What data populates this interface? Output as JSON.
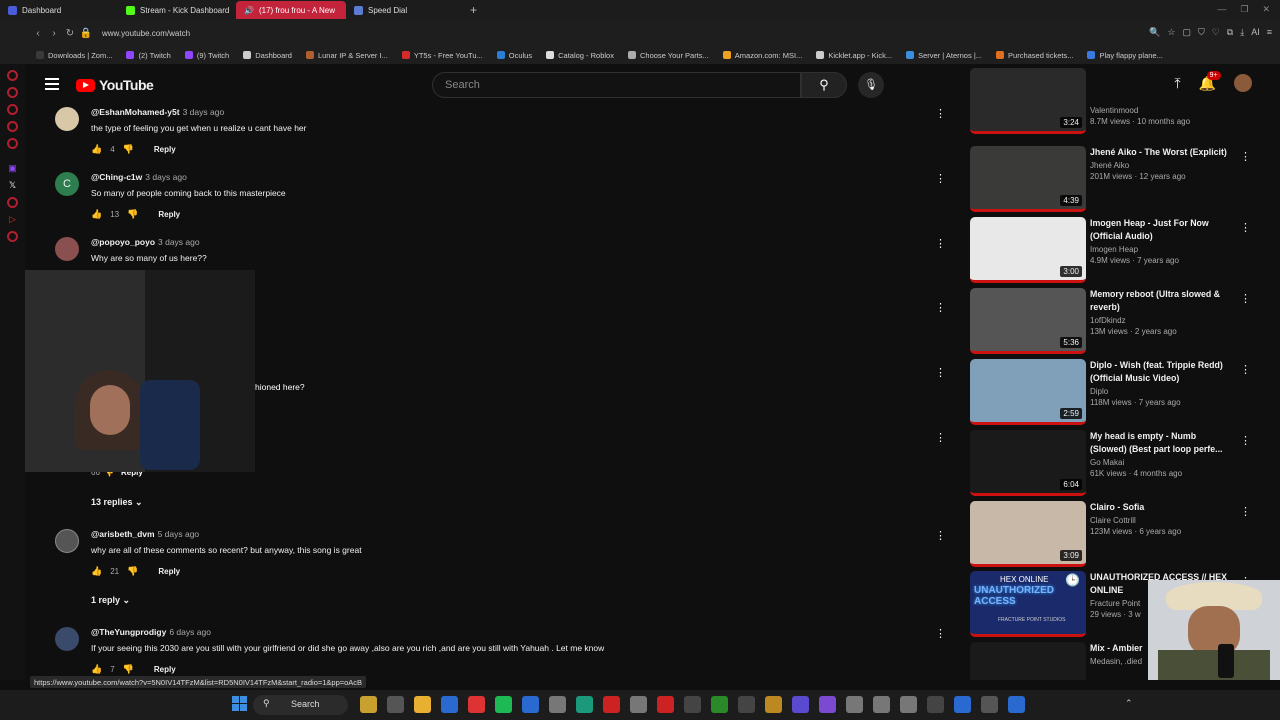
{
  "browser": {
    "tabs": [
      {
        "label": "Dashboard",
        "color": "#4a5cd8"
      },
      {
        "label": "Stream - Kick Dashboard",
        "color": "#53fc18"
      },
      {
        "label": "(17) frou frou - A New",
        "color": "#ffffff"
      },
      {
        "label": "Speed Dial",
        "color": "#5b7bd5"
      }
    ],
    "url": "www.youtube.com/watch",
    "bookmarks": [
      {
        "label": "Downloads | Zom...",
        "color": "#3a3a3a"
      },
      {
        "label": "(2) Twitch",
        "color": "#9146ff"
      },
      {
        "label": "(9) Twitch",
        "color": "#9146ff"
      },
      {
        "label": "Dashboard",
        "color": "#cccccc"
      },
      {
        "label": "Lunar IP & Server I...",
        "color": "#b06030"
      },
      {
        "label": "YT5s - Free YouTu...",
        "color": "#d42a2a"
      },
      {
        "label": "Oculus",
        "color": "#2a7fd4"
      },
      {
        "label": "Catalog - Roblox",
        "color": "#dddddd"
      },
      {
        "label": "Choose Your Parts...",
        "color": "#aaaaaa"
      },
      {
        "label": "Amazon.com: MSI...",
        "color": "#f0a020"
      },
      {
        "label": "Kicklet.app - Kick...",
        "color": "#cccccc"
      },
      {
        "label": "Server | Aternos |...",
        "color": "#3a8ee0"
      },
      {
        "label": "Purchased tickets...",
        "color": "#e07020"
      },
      {
        "label": "Play flappy plane...",
        "color": "#3a7ae0"
      }
    ]
  },
  "youtube": {
    "logo": "YouTube",
    "search_placeholder": "Search",
    "notif_badge": "9+",
    "comments": [
      {
        "user": "@EshanMohamed-y5t",
        "ago": "3 days ago",
        "text": "the type of feeling you get when u realize u cant have her",
        "likes": "4",
        "reply": "Reply",
        "avatar_color": "#d8c8a8"
      },
      {
        "user": "@Ching-c1w",
        "ago": "3 days ago",
        "text": "So many of people coming back to this masterpiece",
        "likes": "13",
        "reply": "Reply",
        "avatar_color": "#2e7d4f",
        "initial": "C"
      },
      {
        "user": "@popoyo_poyo",
        "ago": "3 days ago",
        "text": "Why are so many of us here??",
        "likes": "",
        "reply": "",
        "avatar_color": "#8a5050"
      },
      {
        "user": "@arisbeth_dvm",
        "ago": "5 days ago",
        "text": "why are all of these comments so recent? but anyway, this song is great",
        "likes": "21",
        "reply": "Reply",
        "avatar_color": "#555555"
      },
      {
        "user": "@TheYungprodigy",
        "ago": "6 days ago",
        "text": "If your seeing this 2030 are you still with your girlfriend or did she go away ,also are you rich ,and are you still with Yahuah . Let me know",
        "likes": "7",
        "reply": "Reply",
        "avatar_color": "#3a4a6a"
      }
    ],
    "partial_text": "hioned here?",
    "partial_reply": "Reply",
    "partial_likes": "66",
    "replies_13": "13 replies",
    "replies_1": "1 reply",
    "videos": [
      {
        "title": "Valentinmood",
        "channel": "",
        "meta": "8.7M views · 10 months ago",
        "duration": "3:24",
        "color": "#2a2a2a"
      },
      {
        "title": "Jhené Aiko - The Worst (Explicit)",
        "channel": "Jhené Aiko",
        "meta": "201M views · 12 years ago",
        "duration": "4:39",
        "color": "#3a3a38"
      },
      {
        "title": "Imogen Heap - Just For Now (Official Audio)",
        "channel": "Imogen Heap",
        "meta": "4.9M views · 7 years ago",
        "duration": "3:00",
        "color": "#e8e8e8"
      },
      {
        "title": "Memory reboot (Ultra slowed & reverb)",
        "channel": "1ofDkindz",
        "meta": "13M views · 2 years ago",
        "duration": "5:36",
        "color": "#555555"
      },
      {
        "title": "Diplo - Wish (feat. Trippie Redd) (Official Music Video)",
        "channel": "Diplo",
        "meta": "118M views · 7 years ago",
        "duration": "2:59",
        "color": "#7fa0b8"
      },
      {
        "title": "My head is empty - Numb (Slowed) (Best part loop perfe...",
        "channel": "Go Makai",
        "meta": "61K views · 4 months ago",
        "duration": "6:04",
        "color": "#1a1a1a"
      },
      {
        "title": "Clairo - Sofia",
        "channel": "Claire Cottrill",
        "meta": "123M views · 6 years ago",
        "duration": "3:09",
        "color": "#c8b8a8"
      },
      {
        "title": "UNAUTHORIZED ACCESS // HEX ONLINE",
        "channel": "Fracture Point",
        "meta": "29 views · 3 w",
        "duration": "",
        "color": "#1a2a6a"
      },
      {
        "title": "Mix - Ambier",
        "channel": "Medasin, .died",
        "meta": "",
        "duration": "",
        "color": "#1a1a1a"
      }
    ],
    "thumb_label_unauth": "UNAUTHORIZED ACCESS",
    "thumb_label_hex": "HEX ONLINE",
    "thumb_label_fracture": "FRACTURE POINT STUDIOS"
  },
  "status_url": "https://www.youtube.com/watch?v=5N0IV14TFzM&list=RD5N0IV14TFzM&start_radio=1&pp=oAcB",
  "taskbar": {
    "search": "Search"
  }
}
